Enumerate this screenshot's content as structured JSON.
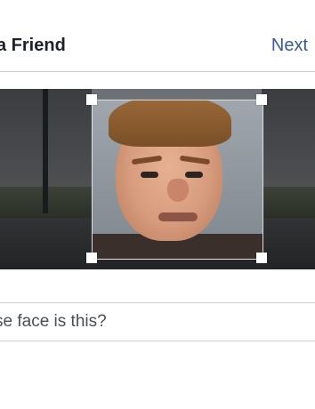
{
  "header": {
    "title": "a Friend",
    "next_label": "Next"
  },
  "photo": {
    "subject": "face-crop"
  },
  "question": {
    "text": "se face is this?"
  },
  "colors": {
    "link": "#3b5998",
    "title": "#1d2129",
    "divider": "#c9ccd3"
  }
}
